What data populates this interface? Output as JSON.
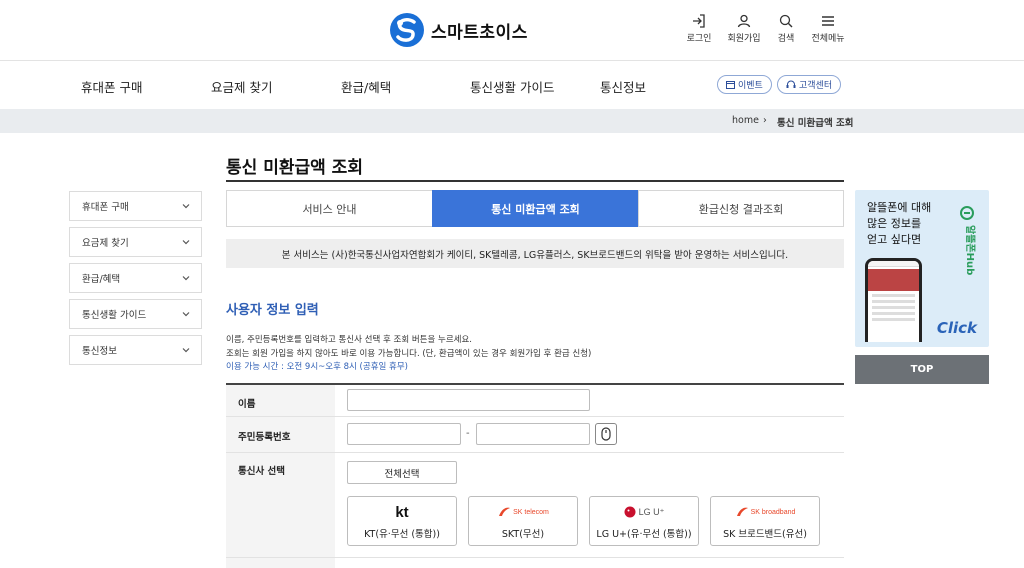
{
  "header": {
    "logo_text": "스마트초이스",
    "utils": [
      {
        "label": "로그인",
        "icon": "login-icon"
      },
      {
        "label": "회원가입",
        "icon": "user-icon"
      },
      {
        "label": "검색",
        "icon": "search-icon"
      },
      {
        "label": "전체메뉴",
        "icon": "menu-icon"
      }
    ]
  },
  "gnb": {
    "items": [
      "휴대폰 구매",
      "요금제 찾기",
      "환급/혜택",
      "통신생활 가이드",
      "통신정보"
    ],
    "event_label": "이벤트",
    "support_label": "고객센터"
  },
  "breadcrumb": {
    "home": "home",
    "current": "통신 미환급액 조회"
  },
  "sidebar": {
    "items": [
      "휴대폰 구매",
      "요금제 찾기",
      "환급/혜택",
      "통신생활 가이드",
      "통신정보"
    ]
  },
  "main": {
    "title": "통신 미환급액 조회",
    "tabs": [
      {
        "label": "서비스 안내",
        "active": false
      },
      {
        "label": "통신 미환급액 조회",
        "active": true
      },
      {
        "label": "환급신청 결과조회",
        "active": false
      }
    ],
    "notice": "본 서비스는 (사)한국통신사업자연합회가 케이티, SK텔레콤, LG유플러스, SK브로드밴드의 위탁을 받아 운영하는 서비스입니다.",
    "section_title": "사용자 정보 입력",
    "guide_1": "이름, 주민등록번호를 입력하고 통신사 선택 후 조회 버튼을 누르세요.",
    "guide_2": "조회는 회원 가입을 하지 않아도 바로 이용 가능합니다. (단, 환급액이 있는 경우 회원가입 후 환급 신청)",
    "guide_3": "이용 가능 시간 : 오전 9시~오후 8시 (공휴일 휴무)",
    "form": {
      "name_label": "이름",
      "name_value": "",
      "rrn_label": "주민등록번호",
      "rrn_front": "",
      "rrn_back": "",
      "rrn_dash": "-",
      "carrier_label": "통신사 선택",
      "select_all": "전체선택",
      "carriers": [
        {
          "logo": "kt",
          "label": "KT(유·무선 (통합))"
        },
        {
          "logo": "SK telecom",
          "label": "SKT(무선)"
        },
        {
          "logo": "LG U⁺",
          "label": "LG U+(유·무선 (통합))"
        },
        {
          "logo": "SK broadband",
          "label": "SK 브로드밴드(유선)"
        }
      ]
    }
  },
  "banner": {
    "line1": "알뜰폰에 대해",
    "line2": "많은 정보를",
    "line3": "얻고 싶다면",
    "click": "Click",
    "hub_text": "알뜰폰Hub"
  },
  "top_button": "TOP",
  "colors": {
    "accent": "#3a74d9",
    "section_blue": "#2f5fb5",
    "logo_blue": "#1a6fd6"
  }
}
